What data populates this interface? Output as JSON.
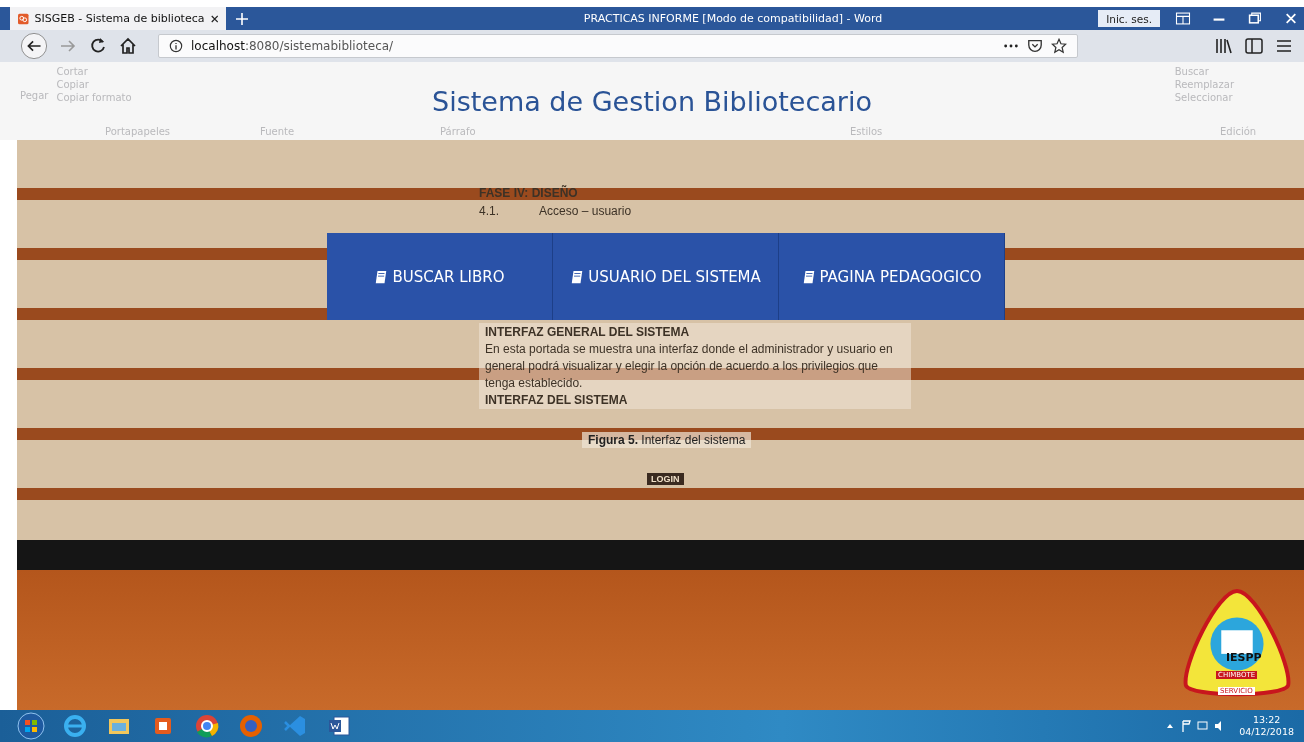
{
  "word_window": {
    "title": "PRACTICAS INFORME [Modo de compatibilidad]  -  Word",
    "sign_in": "Inic. ses.",
    "clipboard": {
      "paste": "Pegar",
      "items": [
        "Cortar",
        "Copiar",
        "Copiar formato"
      ]
    },
    "editing_items": [
      "Buscar",
      "Reemplazar",
      "Seleccionar"
    ],
    "ribbon_groups": [
      "Portapapeles",
      "Fuente",
      "Párrafo",
      "Estilos",
      "Edición"
    ],
    "document": {
      "phase": "FASE IV: DISEÑO",
      "section_number": "4.1.",
      "section_title": "Acceso – usuario",
      "heading": "INTERFAZ GENERAL DEL SISTEMA",
      "paragraph": "En esta portada se muestra una interfaz donde el administrador y usuario en general podrá visualizar y elegir la opción de acuerdo a los privilegios que tenga establecido.",
      "heading_2": "INTERFAZ DEL SISTEMA",
      "caption": "**Figura 5.** Interfaz del sistema",
      "login": "LOGIN"
    }
  },
  "browser": {
    "tab_title": "SISGEB - Sistema de biblioteca",
    "url_host": "localhost",
    "url_path": ":8080/sistemabiblioteca/"
  },
  "page": {
    "title": "Sistema de Gestion Bibliotecario",
    "nav_buttons": [
      "BUSCAR LIBRO",
      "USUARIO DEL SISTEMA",
      "PAGINA PEDAGOGICO"
    ],
    "logo": {
      "name": "IESPP",
      "city": "CHIMBOTE",
      "motto": "SERVICIO"
    }
  },
  "taskbar": {
    "time": "13:22",
    "date": "04/12/2018"
  }
}
